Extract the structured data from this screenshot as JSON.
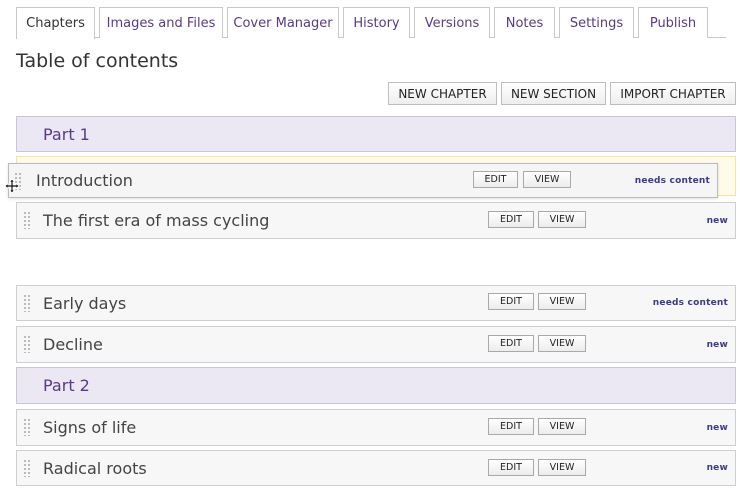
{
  "tabs": [
    {
      "label": "Chapters",
      "active": true
    },
    {
      "label": "Images and Files",
      "active": false
    },
    {
      "label": "Cover Manager",
      "active": false
    },
    {
      "label": "History",
      "active": false
    },
    {
      "label": "Versions",
      "active": false
    },
    {
      "label": "Notes",
      "active": false
    },
    {
      "label": "Settings",
      "active": false
    },
    {
      "label": "Publish",
      "active": false
    }
  ],
  "page_title": "Table of contents",
  "toolbar": {
    "new_chapter": "NEW CHAPTER",
    "new_section": "NEW SECTION",
    "import_chapter": "IMPORT CHAPTER"
  },
  "row_buttons": {
    "edit": "EDIT",
    "view": "VIEW"
  },
  "toc": {
    "part1": {
      "title": "Part 1"
    },
    "dragging": {
      "title": "Introduction",
      "status": "needs content"
    },
    "first_era": {
      "title": "The first era of mass cycling",
      "status": "new"
    },
    "early_days": {
      "title": "Early days",
      "status": "needs content"
    },
    "decline": {
      "title": "Decline",
      "status": "new"
    },
    "part2": {
      "title": "Part 2"
    },
    "signs_of_life": {
      "title": "Signs of life",
      "status": "new"
    },
    "radical_roots": {
      "title": "Radical roots",
      "status": "new"
    }
  },
  "colors": {
    "accent": "#5a3a86",
    "status": "#3d3a8a",
    "part_bg": "#ece8f3",
    "drop_highlight": "#fffbe8"
  },
  "icons": {
    "drag_handle": "grip-dots-icon",
    "cursor": "move-cursor-icon"
  }
}
